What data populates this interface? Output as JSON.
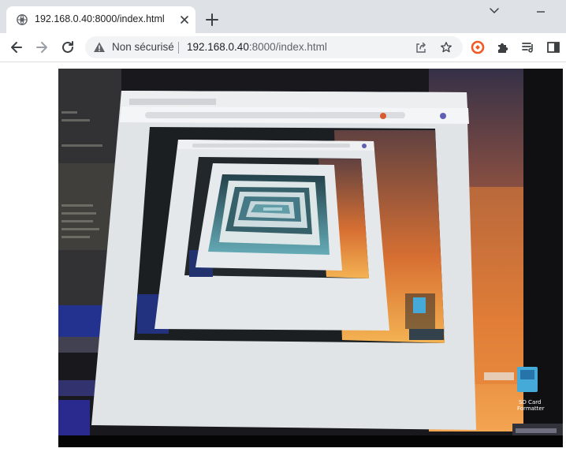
{
  "tab": {
    "title": "192.168.0.40:8000/index.html",
    "favicon": "globe-icon"
  },
  "toolbar": {
    "security_label": "Non sécurisé",
    "url_host": "192.168.0.40",
    "url_rest": ":8000/index.html"
  },
  "icons": {
    "back": "back-arrow-icon",
    "forward": "forward-arrow-icon",
    "reload": "reload-icon",
    "share": "share-icon",
    "bookmark": "star-icon",
    "extension_brave": "brave-lion-icon",
    "extensions": "puzzle-icon",
    "reading_list": "reading-list-icon",
    "side_panel": "side-panel-icon"
  },
  "stream": {
    "desktop_icon_label_1": "SD Card",
    "desktop_icon_label_2": "Formatter"
  },
  "colors": {
    "tabstrip_bg": "#dee1e6",
    "omnibox_bg": "#f1f3f4",
    "brave_orange": "#f15a24",
    "warning_grey": "#5f6368"
  }
}
